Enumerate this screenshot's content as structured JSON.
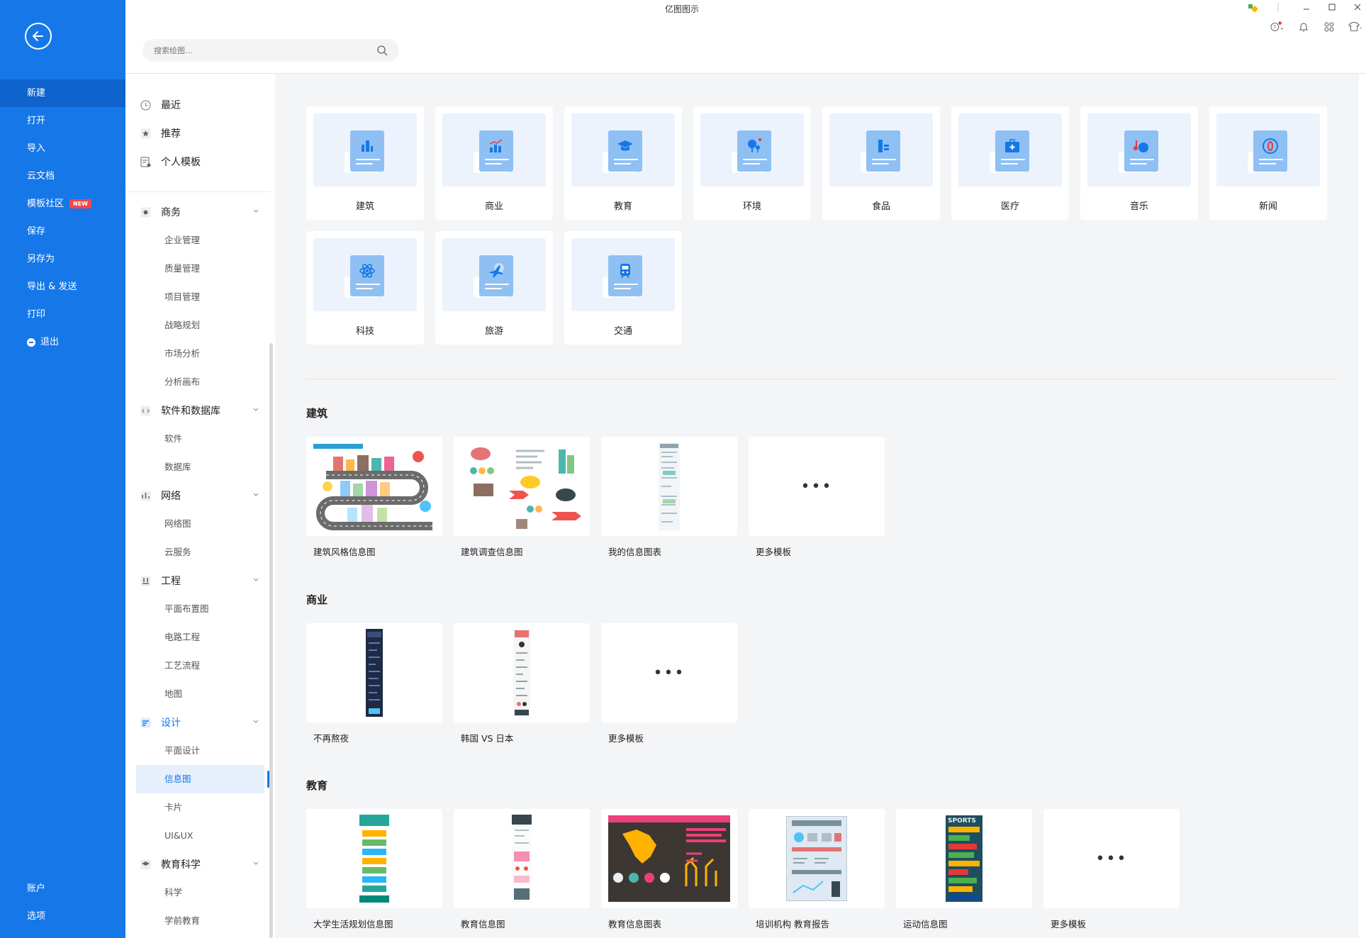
{
  "app": {
    "title": "亿图图示"
  },
  "search": {
    "placeholder": "搜索绘图..."
  },
  "rail": {
    "items": [
      {
        "label": "新建",
        "active": true
      },
      {
        "label": "打开"
      },
      {
        "label": "导入"
      },
      {
        "label": "云文档"
      },
      {
        "label": "模板社区",
        "badge": "NEW"
      },
      {
        "label": "保存"
      },
      {
        "label": "另存为"
      },
      {
        "label": "导出 & 发送"
      },
      {
        "label": "打印"
      },
      {
        "label": "退出"
      }
    ],
    "bottom": [
      {
        "label": "账户"
      },
      {
        "label": "选项"
      }
    ]
  },
  "sidebar": {
    "top": [
      {
        "label": "最近"
      },
      {
        "label": "推荐"
      },
      {
        "label": "个人模板"
      }
    ],
    "groups": [
      {
        "label": "商务",
        "subs": [
          "企业管理",
          "质量管理",
          "项目管理",
          "战略规划",
          "市场分析",
          "分析画布"
        ]
      },
      {
        "label": "软件和数据库",
        "subs": [
          "软件",
          "数据库"
        ]
      },
      {
        "label": "网络",
        "subs": [
          "网络图",
          "云服务"
        ]
      },
      {
        "label": "工程",
        "subs": [
          "平面布置图",
          "电路工程",
          "工艺流程",
          "地图"
        ]
      },
      {
        "label": "设计",
        "subs": [
          "平面设计",
          "信息图",
          "卡片",
          "UI&UX"
        ]
      },
      {
        "label": "教育科学",
        "subs": [
          "科学",
          "学前教育"
        ]
      }
    ]
  },
  "categories": [
    {
      "label": "建筑",
      "icon": "building-icon"
    },
    {
      "label": "商业",
      "icon": "bar-chart-icon"
    },
    {
      "label": "教育",
      "icon": "graduation-cap-icon"
    },
    {
      "label": "环境",
      "icon": "tree-icon"
    },
    {
      "label": "食品",
      "icon": "food-icon"
    },
    {
      "label": "医疗",
      "icon": "medical-kit-icon"
    },
    {
      "label": "音乐",
      "icon": "music-icon"
    },
    {
      "label": "新闻",
      "icon": "news-icon"
    },
    {
      "label": "科技",
      "icon": "atom-icon"
    },
    {
      "label": "旅游",
      "icon": "airplane-icon"
    },
    {
      "label": "交通",
      "icon": "train-icon"
    }
  ],
  "sections": [
    {
      "title": "建筑",
      "templates": [
        "建筑风格信息图",
        "建筑调查信息图",
        "我的信息图表",
        "更多模板"
      ]
    },
    {
      "title": "商业",
      "templates": [
        "不再熬夜",
        "韩国 VS 日本",
        "更多模板"
      ]
    },
    {
      "title": "教育",
      "templates": [
        "大学生活规划信息图",
        "教育信息图",
        "教育信息图表",
        "培训机构  教育报告",
        "运动信息图",
        "更多模板"
      ]
    }
  ],
  "colors": {
    "accent": "#1677e8",
    "rail": "#1677e8",
    "badge": "#f0474b"
  }
}
